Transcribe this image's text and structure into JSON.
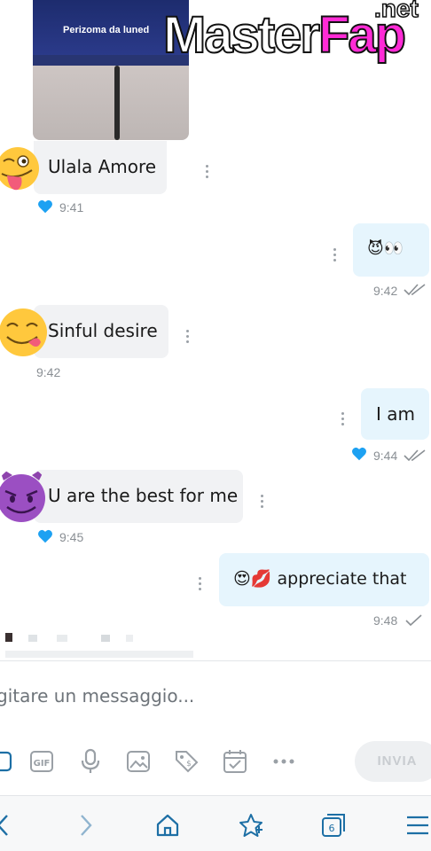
{
  "photo": {
    "caption": "Perizoma da luned"
  },
  "watermark": {
    "main": "Master",
    "accent": "Fap",
    "suffix": ".net"
  },
  "messages": [
    {
      "dir": "in",
      "text": "Ulala Amore",
      "time": "9:41",
      "liked": true
    },
    {
      "dir": "out",
      "text": "😈👀",
      "time": "9:42",
      "read": true
    },
    {
      "dir": "in",
      "text": "Sinful desire",
      "time": "9:42"
    },
    {
      "dir": "out",
      "text": "I am",
      "time": "9:44",
      "liked": true,
      "read": true
    },
    {
      "dir": "in",
      "text": "U are the best for me",
      "time": "9:45",
      "liked": true
    },
    {
      "dir": "out",
      "text": "😍💋 appreciate that",
      "time": "9:48",
      "sent": true
    }
  ],
  "composer": {
    "placeholder": "gitare un messaggio...",
    "send_label": "INVIA",
    "tools": [
      "attachment-icon",
      "gif-icon",
      "microphone-icon",
      "image-icon",
      "price-tag-icon",
      "calendar-icon",
      "more-icon"
    ],
    "gif_label": "GIF"
  },
  "browser_nav": {
    "tab_count": "6",
    "icons": [
      "back-icon",
      "forward-icon",
      "home-icon",
      "favorites-icon",
      "tabs-icon",
      "menu-icon"
    ]
  },
  "colors": {
    "accent": "#1da1f2",
    "incoming_bubble": "#f1f2f4",
    "outgoing_bubble": "#e6f5fd",
    "watermark_accent": "#ff2bd6"
  }
}
